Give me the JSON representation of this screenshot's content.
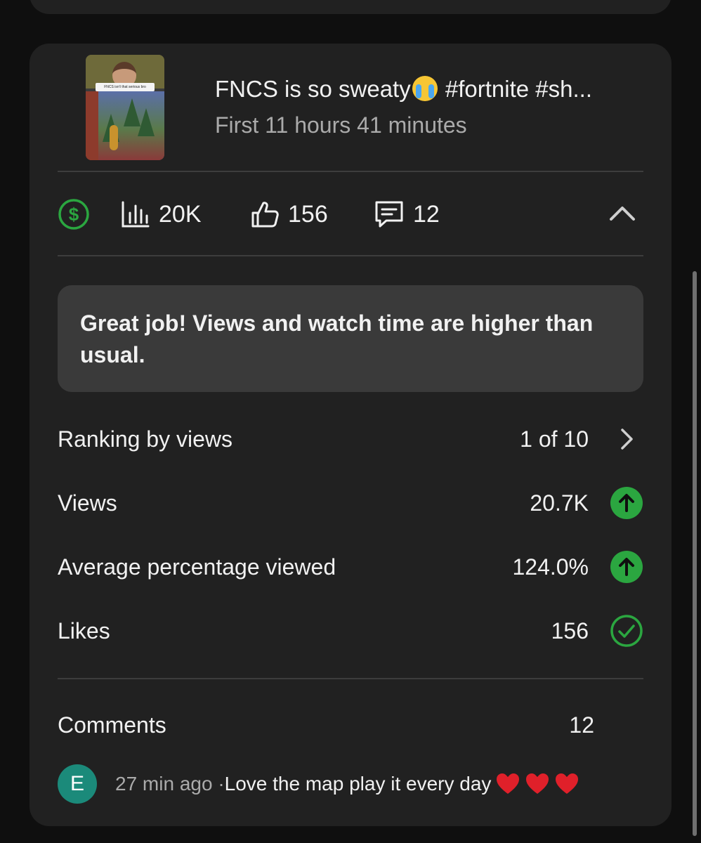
{
  "video": {
    "title_prefix": "FNCS is so sweaty",
    "title_suffix": " #fortnite #sh...",
    "subtitle": "First 11 hours 41 minutes",
    "thumbnail_caption": "FNCS isn't that serious bro"
  },
  "stats": {
    "monetization_icon": "dollar-circle-icon",
    "views": "20K",
    "likes": "156",
    "comments": "12"
  },
  "banner": {
    "text": "Great job! Views and watch time are higher than usual."
  },
  "metrics": [
    {
      "label": "Ranking by views",
      "value": "1 of 10",
      "indicator": "chevron-right-icon"
    },
    {
      "label": "Views",
      "value": "20.7K",
      "indicator": "arrow-up-circle-icon"
    },
    {
      "label": "Average percentage viewed",
      "value": "124.0%",
      "indicator": "arrow-up-circle-icon"
    },
    {
      "label": "Likes",
      "value": "156",
      "indicator": "check-circle-icon"
    }
  ],
  "comments": {
    "label": "Comments",
    "count": "12",
    "latest": {
      "avatar_letter": "E",
      "time": "27 min ago · ",
      "text": "Love the map play it every day"
    }
  },
  "colors": {
    "background": "#0f0f0f",
    "card": "#212121",
    "banner": "#3a3a3a",
    "accent_green": "#2ba640",
    "avatar": "#1b8a7a"
  }
}
